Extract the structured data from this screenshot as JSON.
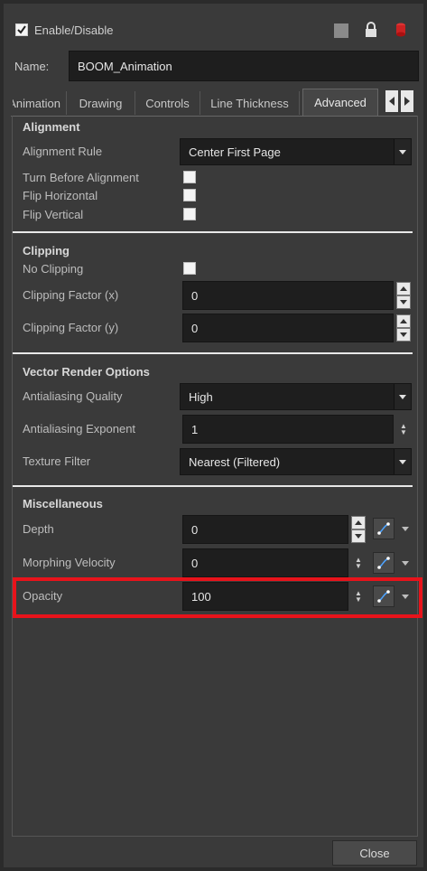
{
  "header": {
    "enable_label": "Enable/Disable"
  },
  "name_row": {
    "label": "Name:",
    "value": "BOOM_Animation"
  },
  "tabs": [
    {
      "label": "Animation"
    },
    {
      "label": "Drawing"
    },
    {
      "label": "Controls"
    },
    {
      "label": "Line Thickness"
    },
    {
      "label": "Advanced"
    }
  ],
  "alignment": {
    "header": "Alignment",
    "rule_label": "Alignment Rule",
    "rule_value": "Center First Page",
    "turn_before": "Turn Before Alignment",
    "flip_h": "Flip Horizontal",
    "flip_v": "Flip Vertical"
  },
  "clipping": {
    "header": "Clipping",
    "no_clipping": "No Clipping",
    "factor_x_label": "Clipping Factor (x)",
    "factor_x_value": "0",
    "factor_y_label": "Clipping Factor (y)",
    "factor_y_value": "0"
  },
  "vector": {
    "header": "Vector Render Options",
    "aa_quality_label": "Antialiasing Quality",
    "aa_quality_value": "High",
    "aa_exponent_label": "Antialiasing Exponent",
    "aa_exponent_value": "1",
    "texture_label": "Texture Filter",
    "texture_value": "Nearest (Filtered)"
  },
  "misc": {
    "header": "Miscellaneous",
    "depth_label": "Depth",
    "depth_value": "0",
    "morph_label": "Morphing Velocity",
    "morph_value": "0",
    "opacity_label": "Opacity",
    "opacity_value": "100"
  },
  "footer": {
    "close_label": "Close"
  },
  "colors": {
    "highlight": "#e8131b",
    "panel": "#3a3a3a",
    "field": "#1e1e1e"
  }
}
